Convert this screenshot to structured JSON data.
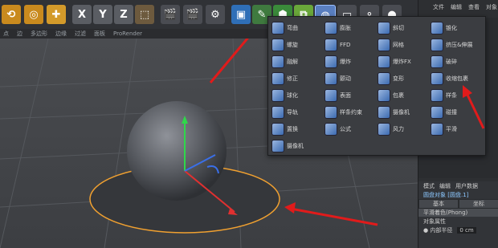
{
  "toolbar": {
    "buttons": [
      "X",
      "Y",
      "Z"
    ]
  },
  "menubar": {
    "items": [
      "点",
      "边",
      "多边形",
      "边缘",
      "过滤",
      "面板",
      "ProRender"
    ]
  },
  "right_panel": {
    "tabs": [
      "文件",
      "编辑",
      "查看",
      "对象"
    ],
    "attr_tabs": [
      "模式",
      "编辑",
      "用户数据"
    ],
    "object_label": "圆盘对象 [圆盘.1]",
    "sub_tabs": [
      "基本",
      "坐标"
    ],
    "shading": "平滑着色(Phong)",
    "section": "对象属性",
    "field_label": "● 内部半径",
    "field_value": "0 cm"
  },
  "deformer_menu": {
    "col1": [
      "弯曲",
      "螺旋",
      "融解",
      "修正",
      "球化",
      "导轨",
      "置换",
      "摄像机"
    ],
    "col2": [
      "膨胀",
      "FFD",
      "爆炸",
      "颤动",
      "表面",
      "样条约束",
      "公式"
    ],
    "col3": [
      "斜切",
      "网格",
      "爆炸FX",
      "变形",
      "包裹",
      "摄像机",
      "风力"
    ],
    "col4": [
      "锥化",
      "挤压&伸展",
      "破碎",
      "收缩包裹",
      "样条",
      "碰撞",
      "平滑"
    ]
  },
  "colors": {
    "arrow": "#e11b1b",
    "accent": "#f0a030"
  }
}
